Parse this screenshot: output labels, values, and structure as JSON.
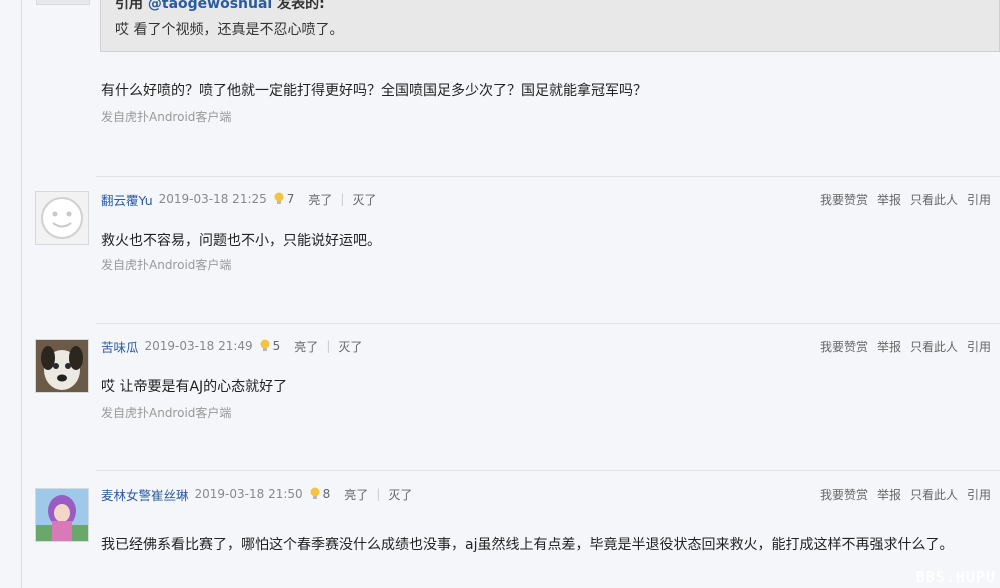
{
  "quote": {
    "prefix": "引用 ",
    "author": "@taogewoshuai",
    "suffix": " 发表的:",
    "text": "哎 看了个视频，还真是不忍心喷了。"
  },
  "reply": {
    "text": "有什么好喷的？喷了他就一定能打得更好吗？全国喷国足多少次了？国足就能拿冠军吗？",
    "source": "发自虎扑Android客户端"
  },
  "actions": {
    "reward": "我要赞赏",
    "report": "举报",
    "only_author": "只看此人",
    "quote": "引用"
  },
  "meta_labels": {
    "light": "亮了",
    "separator": "|",
    "dark": "灭了"
  },
  "posts": [
    {
      "username": "翻云覆Yu",
      "time": "2019-03-18 21:25",
      "light_count": "7",
      "content": "救火也不容易，问题也不小，只能说好运吧。",
      "source": "发自虎扑Android客户端"
    },
    {
      "username": "苦味瓜",
      "time": "2019-03-18 21:49",
      "light_count": "5",
      "content": "哎 让帝要是有AJ的心态就好了",
      "source": "发自虎扑Android客户端"
    },
    {
      "username": "麦林女警崔丝琳",
      "time": "2019-03-18 21:50",
      "light_count": "8",
      "content": "我已经佛系看比赛了，哪怕这个春季赛没什么成绩也没事，aj虽然线上有点差，毕竟是半退役状态回来救火，能打成这样不再强求什么了。"
    }
  ],
  "watermark": "BBS.HUPU"
}
